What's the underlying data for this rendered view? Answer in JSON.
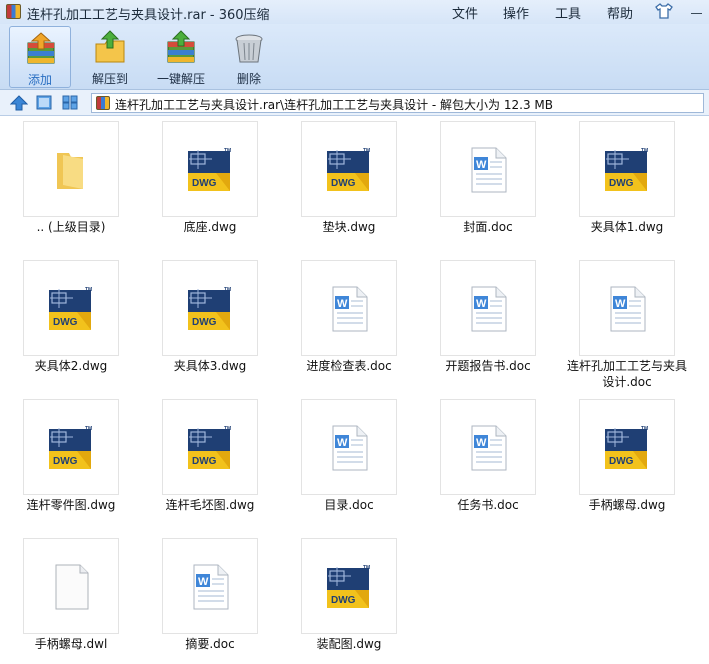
{
  "window": {
    "title": "连杆孔加工工艺与夹具设计.rar - 360压缩",
    "menu": [
      "文件",
      "操作",
      "工具",
      "帮助"
    ]
  },
  "toolbar": {
    "add_label": "添加",
    "extract_label": "解压到",
    "oneclick_label": "一键解压",
    "delete_label": "删除"
  },
  "addressbar": {
    "path": "连杆孔加工工艺与夹具设计.rar\\连杆孔加工工艺与夹具设计 - 解包大小为 12.3 MB"
  },
  "files": [
    {
      "name": ".. (上级目录)",
      "type": "folder"
    },
    {
      "name": "底座.dwg",
      "type": "dwg"
    },
    {
      "name": "垫块.dwg",
      "type": "dwg"
    },
    {
      "name": "封面.doc",
      "type": "doc"
    },
    {
      "name": "夹具体1.dwg",
      "type": "dwg"
    },
    {
      "name": "夹具体2.dwg",
      "type": "dwg"
    },
    {
      "name": "夹具体3.dwg",
      "type": "dwg"
    },
    {
      "name": "进度检查表.doc",
      "type": "doc"
    },
    {
      "name": "开题报告书.doc",
      "type": "doc"
    },
    {
      "name": "连杆孔加工工艺与夹具设计.doc",
      "type": "doc"
    },
    {
      "name": "连杆零件图.dwg",
      "type": "dwg"
    },
    {
      "name": "连杆毛坯图.dwg",
      "type": "dwg"
    },
    {
      "name": "目录.doc",
      "type": "doc"
    },
    {
      "name": "任务书.doc",
      "type": "doc"
    },
    {
      "name": "手柄螺母.dwg",
      "type": "dwg"
    },
    {
      "name": "手柄螺母.dwl",
      "type": "blank"
    },
    {
      "name": "摘要.doc",
      "type": "doc"
    },
    {
      "name": "装配图.dwg",
      "type": "dwg"
    }
  ],
  "icons": {
    "dwg_badge": "DWG",
    "dwg_tm": "TM",
    "doc_letter": "W"
  },
  "colors": {
    "accent": "#2a6fc2",
    "dwg_blue": "#1f3f74",
    "dwg_yellow": "#f2c21c",
    "folder": "#f5d36a"
  }
}
